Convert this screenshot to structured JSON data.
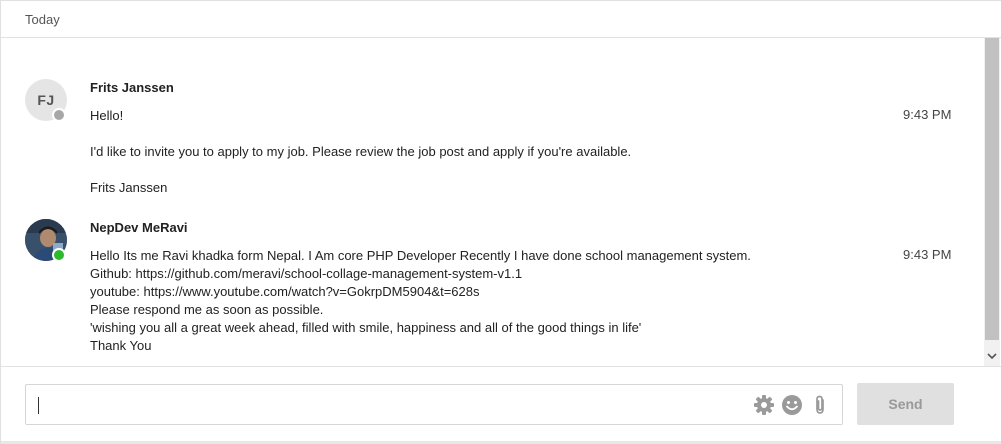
{
  "day_header": {
    "label": "Today"
  },
  "messages": [
    {
      "avatar_initials": "FJ",
      "status": "offline",
      "sender": "Frits Janssen",
      "time": "9:43 PM",
      "lines": [
        "Hello!",
        "I'd like to invite you to apply to my job. Please review the job post and apply if you're available.",
        "Frits Janssen"
      ]
    },
    {
      "avatar_initials": "",
      "status": "online",
      "sender": "NepDev MeRavi",
      "time": "9:43 PM",
      "lines": [
        "Hello Its me Ravi khadka form Nepal. I Am core PHP Developer Recently I have done school management system.",
        "Github: https://github.com/meravi/school-collage-management-system-v1.1",
        "youtube: https://www.youtube.com/watch?v=GokrpDM5904&t=628s",
        "Please respond me as soon as possible.",
        "'wishing you all a great week ahead, filled with smile, happiness and all of the good things in life'",
        "Thank You"
      ]
    }
  ],
  "composer": {
    "input_value": "",
    "send_label": "Send",
    "icons": [
      "gear-icon",
      "emoji-icon",
      "paperclip-icon"
    ]
  },
  "colors": {
    "online": "#2db92d",
    "offline": "#a7a7a7",
    "send_bg": "#e0e0e0",
    "send_text": "#999999"
  }
}
